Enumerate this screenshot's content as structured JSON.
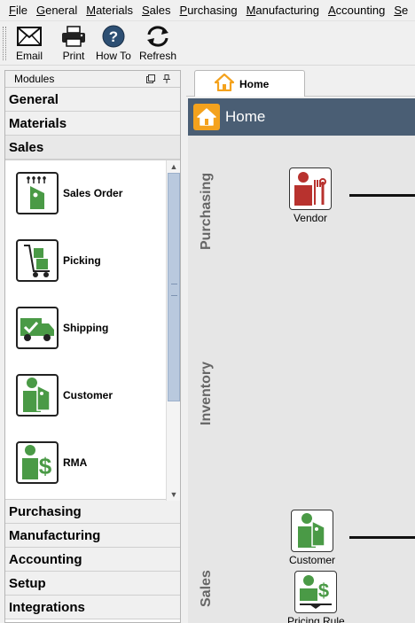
{
  "menubar": {
    "items": [
      "File",
      "General",
      "Materials",
      "Sales",
      "Purchasing",
      "Manufacturing",
      "Accounting",
      "Se"
    ]
  },
  "toolbar": {
    "buttons": [
      {
        "label": "Email",
        "icon": "email-icon"
      },
      {
        "label": "Print",
        "icon": "print-icon"
      },
      {
        "label": "How To",
        "icon": "help-icon"
      },
      {
        "label": "Refresh",
        "icon": "refresh-icon"
      }
    ]
  },
  "modules_panel": {
    "title": "Modules",
    "modules_top": [
      "General",
      "Materials",
      "Sales"
    ],
    "sales_items": [
      {
        "label": "Sales Order",
        "icon": "sales-order-icon"
      },
      {
        "label": "Picking",
        "icon": "picking-icon"
      },
      {
        "label": "Shipping",
        "icon": "shipping-icon"
      },
      {
        "label": "Customer",
        "icon": "customer-icon"
      },
      {
        "label": "RMA",
        "icon": "rma-icon"
      }
    ],
    "modules_bottom": [
      "Purchasing",
      "Manufacturing",
      "Accounting",
      "Setup",
      "Integrations"
    ]
  },
  "tab": {
    "label": "Home"
  },
  "home": {
    "title": "Home",
    "sections": [
      "Purchasing",
      "Inventory",
      "Sales"
    ],
    "nodes": [
      {
        "label": "Vendor",
        "icon": "vendor-icon"
      },
      {
        "label": "Customer",
        "icon": "customer-icon"
      },
      {
        "label": "Pricing Rule",
        "icon": "pricing-rule-icon"
      }
    ]
  },
  "colors": {
    "accent_green": "#4a9a46",
    "vendor_red": "#b8322e",
    "header_slate": "#4a5e74",
    "home_orange": "#f4a21d"
  }
}
